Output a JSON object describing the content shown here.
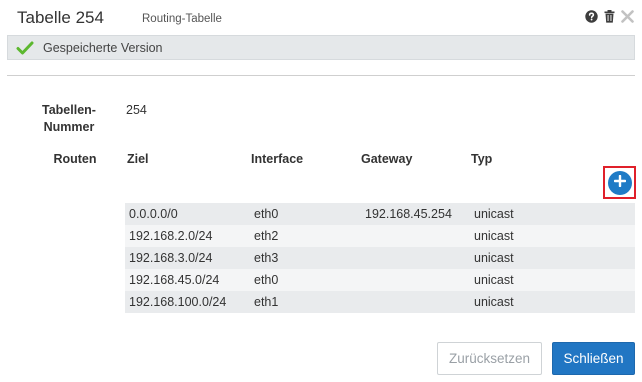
{
  "header": {
    "title": "Tabelle 254",
    "subtitle": "Routing-Tabelle",
    "icons": [
      "help-icon",
      "trash-icon",
      "close-icon"
    ]
  },
  "notice": {
    "icon": "check-icon",
    "text": "Gespeicherte Version",
    "check_color": "#5cb82f"
  },
  "form": {
    "table_number_label_line1": "Tabellen-",
    "table_number_label_line2": "Nummer",
    "table_number_value": "254",
    "routes_label": "Routen"
  },
  "routes": {
    "columns": {
      "ziel": "Ziel",
      "interface": "Interface",
      "gateway": "Gateway",
      "typ": "Typ"
    },
    "rows": [
      {
        "ziel": "0.0.0.0/0",
        "interface": "eth0",
        "gateway": "192.168.45.254",
        "typ": "unicast"
      },
      {
        "ziel": "192.168.2.0/24",
        "interface": "eth2",
        "gateway": "",
        "typ": "unicast"
      },
      {
        "ziel": "192.168.3.0/24",
        "interface": "eth3",
        "gateway": "",
        "typ": "unicast"
      },
      {
        "ziel": "192.168.45.0/24",
        "interface": "eth0",
        "gateway": "",
        "typ": "unicast"
      },
      {
        "ziel": "192.168.100.0/24",
        "interface": "eth1",
        "gateway": "",
        "typ": "unicast"
      }
    ],
    "add_icon": "plus-icon"
  },
  "footer": {
    "reset_label": "Zurücksetzen",
    "close_label": "Schließen"
  },
  "colors": {
    "accent": "#2176c3",
    "highlight": "#e0202a"
  }
}
